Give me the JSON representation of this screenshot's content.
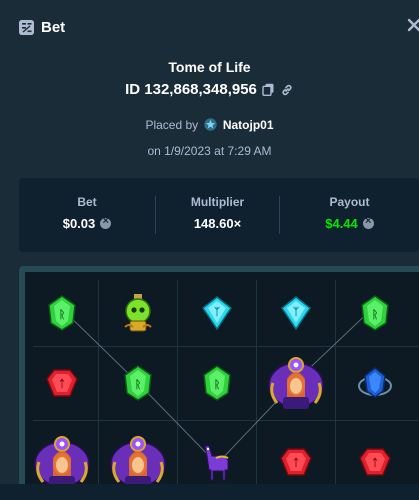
{
  "header": {
    "title": "Bet",
    "bet_icon": "bet-slip-icon",
    "close_icon": "close-icon"
  },
  "game": {
    "name": "Tome of Life"
  },
  "bet": {
    "id_label": "ID 132,868,348,956",
    "copy_icon": "copy-icon",
    "link_icon": "link-icon",
    "placed_by_label": "Placed by",
    "username": "Natojp01",
    "vip_icon": "vip-star-icon",
    "date_label": "on 1/9/2023 at 7:29 AM"
  },
  "stats": {
    "bet": {
      "label": "Bet",
      "value": "$0.03",
      "currency_icon": "coin-icon"
    },
    "multiplier": {
      "label": "Multiplier",
      "value": "148.60×"
    },
    "payout": {
      "label": "Payout",
      "value": "$4.44",
      "currency_icon": "coin-icon",
      "color": "#00e701"
    }
  },
  "board": {
    "rows": [
      [
        "green-gem",
        "skull-potion",
        "cyan-gem",
        "cyan-gem",
        "green-gem"
      ],
      [
        "red-gem",
        "green-gem",
        "green-gem",
        "sorceress",
        "blue-orb"
      ],
      [
        "sorceress",
        "sorceress",
        "purple-llama",
        "red-gem",
        "red-gem"
      ]
    ],
    "colors": {
      "frame": "#274b55",
      "payline": "#6f7f8f"
    }
  }
}
